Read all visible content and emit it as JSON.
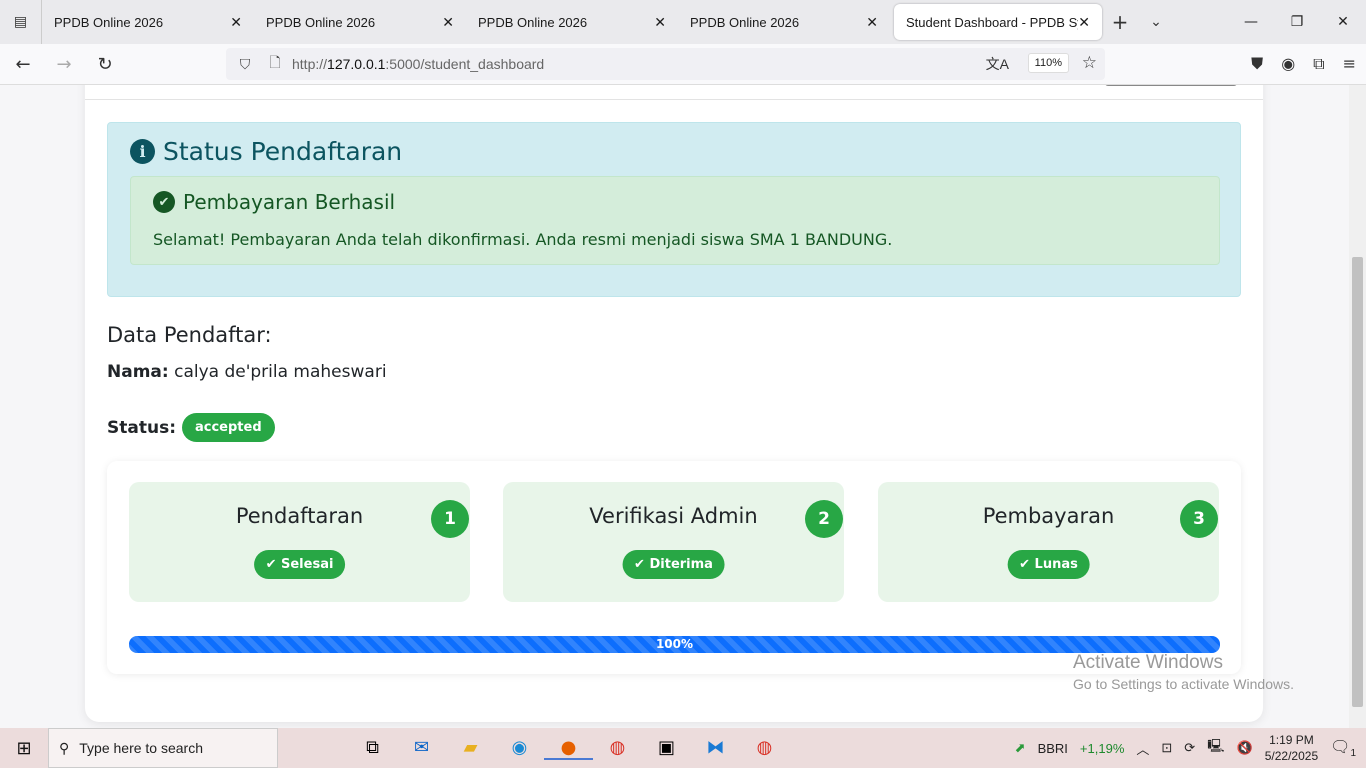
{
  "browser": {
    "tabs": [
      {
        "title": "PPDB Online 2026"
      },
      {
        "title": "PPDB Online 2026"
      },
      {
        "title": "PPDB Online 2026"
      },
      {
        "title": "PPDB Online 2026"
      },
      {
        "title": "Student Dashboard - PPDB Syster"
      }
    ],
    "url_prefix": "http://",
    "url_host": "127.0.0.1",
    "url_path": ":5000/student_dashboard",
    "zoom": "110%"
  },
  "status_box": {
    "title": "Status Pendaftaran",
    "alert_title": "Pembayaran Berhasil",
    "alert_text": "Selamat! Pembayaran Anda telah dikonfirmasi. Anda resmi menjadi siswa SMA 1 BANDUNG."
  },
  "applicant": {
    "heading": "Data Pendaftar:",
    "name_label": "Nama:",
    "name": "calya de'prila maheswari",
    "status_label": "Status:",
    "status": "accepted"
  },
  "steps": [
    {
      "title": "Pendaftaran",
      "number": "1",
      "badge": "Selesai"
    },
    {
      "title": "Verifikasi Admin",
      "number": "2",
      "badge": "Diterima"
    },
    {
      "title": "Pembayaran",
      "number": "3",
      "badge": "Lunas"
    }
  ],
  "progress": {
    "value": 100,
    "label": "100%"
  },
  "watermark": {
    "line1": "Activate Windows",
    "line2": "Go to Settings to activate Windows."
  },
  "taskbar": {
    "search_placeholder": "Type here to search",
    "stock_name": "BBRI",
    "stock_change": "+1,19%",
    "time": "1:19 PM",
    "date": "5/22/2025",
    "notifications": "1"
  },
  "colors": {
    "success": "#28a745",
    "info_bg": "#d1ecf1",
    "progress": "#0d6efd"
  }
}
